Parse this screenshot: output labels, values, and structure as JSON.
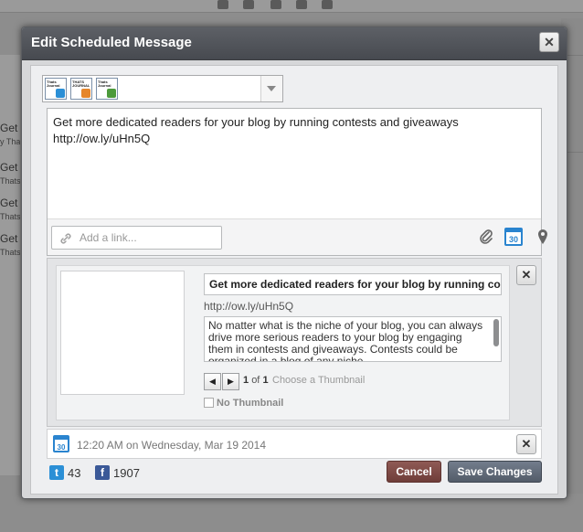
{
  "background": {
    "left_texts": [
      "Get r",
      "y That",
      "Get",
      "Thats",
      "Get",
      "Thats",
      "Get",
      "Thats"
    ]
  },
  "modal": {
    "title": "Edit Scheduled Message",
    "close_glyph": "✕"
  },
  "profiles": [
    {
      "label": "Thats Journal",
      "network": "twitter",
      "badge_color": "#2b8fd6"
    },
    {
      "label": "THATS JOURNAL",
      "network": "blogger",
      "badge_color": "#e6862a"
    },
    {
      "label": "Thats Journal",
      "network": "other",
      "badge_color": "#4c9a3b"
    }
  ],
  "composer": {
    "message": "Get more dedicated readers for your blog by running contests and giveaways\nhttp://ow.ly/uHn5Q",
    "link_placeholder": "Add a link...",
    "icons": [
      "paperclip-icon",
      "calendar-icon",
      "location-pin-icon"
    ],
    "calendar_day": "30"
  },
  "preview": {
    "title": "Get more dedicated readers for your blog by running cor",
    "url": "http://ow.ly/uHn5Q",
    "description": "No matter what is the niche of your blog, you can always drive more serious readers to your blog by engaging them in contests and giveaways. Contests could be organized in a blog of any niche.",
    "prev_glyph": "◀",
    "next_glyph": "▶",
    "current_page": "1",
    "of_word": "of",
    "total_pages": "1",
    "choose_thumbnail": "Choose a Thumbnail",
    "no_thumbnail": "No Thumbnail"
  },
  "schedule": {
    "calendar_day": "30",
    "text": "12:20 AM on Wednesday, Mar 19 2014"
  },
  "stats": {
    "twitter_count": "43",
    "facebook_count": "1907"
  },
  "buttons": {
    "cancel": "Cancel",
    "save": "Save Changes"
  },
  "colors": {
    "twitter": "#2b8fd6",
    "facebook": "#3b5998",
    "cancel_button": "#7a4440",
    "save_button": "#5e6774",
    "header": "#505359"
  }
}
